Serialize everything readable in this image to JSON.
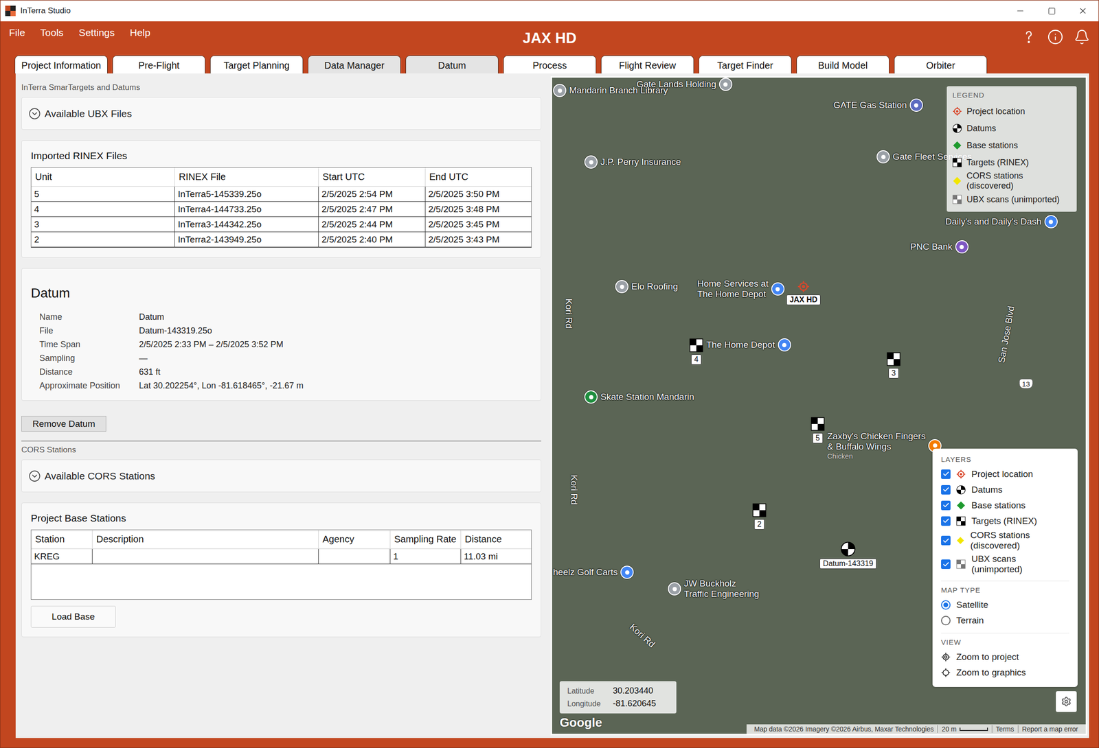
{
  "window": {
    "title": "InTerra Studio"
  },
  "menu": [
    "File",
    "Tools",
    "Settings",
    "Help"
  ],
  "project_title": "JAX HD",
  "tabs": [
    {
      "label": "Project Information",
      "selected": false,
      "hover": false
    },
    {
      "label": "Pre-Flight",
      "selected": false,
      "hover": false
    },
    {
      "label": "Target Planning",
      "selected": false,
      "hover": false
    },
    {
      "label": "Data Manager",
      "selected": true,
      "hover": false
    },
    {
      "label": "Datum",
      "selected": false,
      "hover": true
    },
    {
      "label": "Process",
      "selected": false,
      "hover": false
    },
    {
      "label": "Flight Review",
      "selected": false,
      "hover": false
    },
    {
      "label": "Target Finder",
      "selected": false,
      "hover": false
    },
    {
      "label": "Build Model",
      "selected": false,
      "hover": false
    },
    {
      "label": "Orbiter",
      "selected": false,
      "hover": false
    }
  ],
  "left_panel": {
    "section_smartargets": "InTerra SmarTargets and Datums",
    "ubx": {
      "title": "Available UBX Files",
      "expanded": false
    },
    "rinex": {
      "title": "Imported RINEX Files",
      "columns": [
        "Unit",
        "RINEX File",
        "Start UTC",
        "End UTC"
      ],
      "rows": [
        [
          "5",
          "InTerra5-145339.25o",
          "2/5/2025 2:54 PM",
          "2/5/2025 3:50 PM"
        ],
        [
          "4",
          "InTerra4-144733.25o",
          "2/5/2025 2:47 PM",
          "2/5/2025 3:48 PM"
        ],
        [
          "3",
          "InTerra3-144342.25o",
          "2/5/2025 2:44 PM",
          "2/5/2025 3:45 PM"
        ],
        [
          "2",
          "InTerra2-143949.25o",
          "2/5/2025 2:40 PM",
          "2/5/2025 3:43 PM"
        ]
      ]
    },
    "datum": {
      "title": "Datum",
      "fields": [
        {
          "label": "Name",
          "value": "Datum"
        },
        {
          "label": "File",
          "value": "Datum-143319.25o"
        },
        {
          "label": "Time Span",
          "value": "2/5/2025 2:33 PM – 2/5/2025 3:52 PM"
        },
        {
          "label": "Sampling",
          "value": "—"
        },
        {
          "label": "Distance",
          "value": "631 ft"
        },
        {
          "label": "Approximate Position",
          "value": "Lat 30.202254°, Lon -81.618465°, -21.67 m"
        }
      ]
    },
    "remove_button": "Remove Datum",
    "section_cors": "CORS Stations",
    "cors": {
      "title": "Available CORS Stations",
      "expanded": false
    },
    "base": {
      "title": "Project Base Stations",
      "columns": [
        "Station",
        "Description",
        "Agency",
        "Sampling Rate",
        "Distance"
      ],
      "rows": [
        [
          "KREG",
          "",
          "",
          "1",
          "11.03 mi"
        ]
      ],
      "button": "Load Base"
    }
  },
  "map": {
    "pois": [
      {
        "lines": [
          "Gate Lands Holding"
        ],
        "color": "#9aa0a6"
      },
      {
        "lines": [
          "Mandarin Branch Library"
        ],
        "color": "#9aa0a6"
      },
      {
        "lines": [
          "GATE Gas Station"
        ],
        "color": "#5c6bc0"
      },
      {
        "lines": [
          "J.P. Perry Insurance"
        ],
        "color": "#9aa0a6"
      },
      {
        "lines": [
          "Gate Fleet Services"
        ],
        "color": "#9aa0a6"
      },
      {
        "lines": [
          "Daily's and Daily's Dash"
        ],
        "color": "#4285f4"
      },
      {
        "lines": [
          "PNC Bank"
        ],
        "color": "#7e57c2"
      },
      {
        "lines": [
          "Elo Roofing"
        ],
        "color": "#9aa0a6"
      },
      {
        "lines": [
          "Home Services at",
          "The Home Depot"
        ],
        "color": "#4285f4"
      },
      {
        "lines": [
          "The Home Depot"
        ],
        "color": "#4285f4"
      },
      {
        "lines": [
          "Skate Station Mandarin"
        ],
        "color": "#1e8e3e"
      },
      {
        "lines": [
          "Zaxby's Chicken Fingers",
          "& Buffalo Wings"
        ],
        "sub": "Chicken",
        "color": "#f57c00"
      },
      {
        "lines": [
          "heelz Golf Carts"
        ],
        "color": "#4285f4"
      },
      {
        "lines": [
          "JW Buckholz",
          "Traffic Engineering"
        ],
        "color": "#9aa0a6"
      }
    ],
    "roads": [
      "Kori Rd",
      "Kori Rd",
      "Kori Rd",
      "San Jose Blvd"
    ],
    "shields": [
      "13"
    ],
    "project": {
      "label": "JAX HD"
    },
    "targets": [
      {
        "label": "4"
      },
      {
        "label": "3"
      },
      {
        "label": "5"
      },
      {
        "label": "2"
      }
    ],
    "datums": [
      {
        "label": "Datum-143319"
      }
    ],
    "legend": {
      "title": "LEGEND",
      "items": [
        {
          "label": "Project location",
          "kind": "project"
        },
        {
          "label": "Datums",
          "kind": "datum"
        },
        {
          "label": "Base stations",
          "kind": "base"
        },
        {
          "label": "Targets (RINEX)",
          "kind": "target"
        },
        {
          "label": "CORS stations (discovered)",
          "kind": "cors"
        },
        {
          "label": "UBX scans (unimported)",
          "kind": "ubx"
        }
      ]
    },
    "layers": {
      "title": "LAYERS",
      "items": [
        {
          "label": "Project location",
          "kind": "project",
          "checked": true
        },
        {
          "label": "Datums",
          "kind": "datum",
          "checked": true
        },
        {
          "label": "Base stations",
          "kind": "base",
          "checked": true
        },
        {
          "label": "Targets (RINEX)",
          "kind": "target",
          "checked": true
        },
        {
          "label": "CORS stations (discovered)",
          "kind": "cors",
          "checked": true
        },
        {
          "label": "UBX scans (unimported)",
          "kind": "ubx",
          "checked": true
        }
      ]
    },
    "map_type": {
      "title": "MAP TYPE",
      "options": [
        {
          "label": "Satellite",
          "selected": true
        },
        {
          "label": "Terrain",
          "selected": false
        }
      ]
    },
    "view": {
      "title": "VIEW",
      "items": [
        {
          "label": "Zoom to project",
          "kind": "project"
        },
        {
          "label": "Zoom to graphics",
          "kind": "graphics"
        }
      ]
    },
    "coords": {
      "lat_label": "Latitude",
      "lat": "30.203440",
      "lon_label": "Longitude",
      "lon": "-81.620645"
    },
    "logo": "Google",
    "attribution": {
      "data": "Map data ©2026 Imagery ©2026 Airbus, Maxar Technologies",
      "scale": "20 m",
      "links": [
        "Terms",
        "Report a map error"
      ]
    }
  }
}
